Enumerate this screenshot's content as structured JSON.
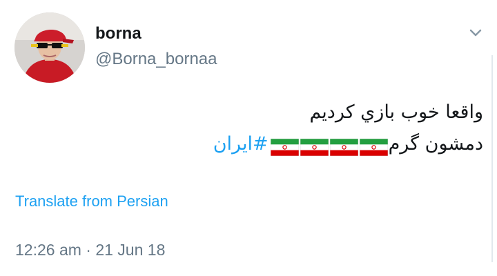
{
  "tweet": {
    "author": {
      "display_name": "borna",
      "handle": "@Borna_bornaa",
      "avatar_icon": "profile-photo"
    },
    "text": {
      "line1": "واقعا خوب بازي كرديم",
      "line2_prefix": "دمشون گرم",
      "flags": [
        "flag-iran",
        "flag-iran",
        "flag-iran",
        "flag-iran"
      ],
      "hashtag": "#ايران"
    },
    "translate_label": "Translate from Persian",
    "timestamp": "12:26 am · 21 Jun 18",
    "menu_icon": "chevron-down-icon"
  },
  "colors": {
    "link": "#1da1f2",
    "secondary_text": "#657786",
    "primary_text": "#14171a",
    "flag_green": "#239f40",
    "flag_red": "#da0000"
  }
}
